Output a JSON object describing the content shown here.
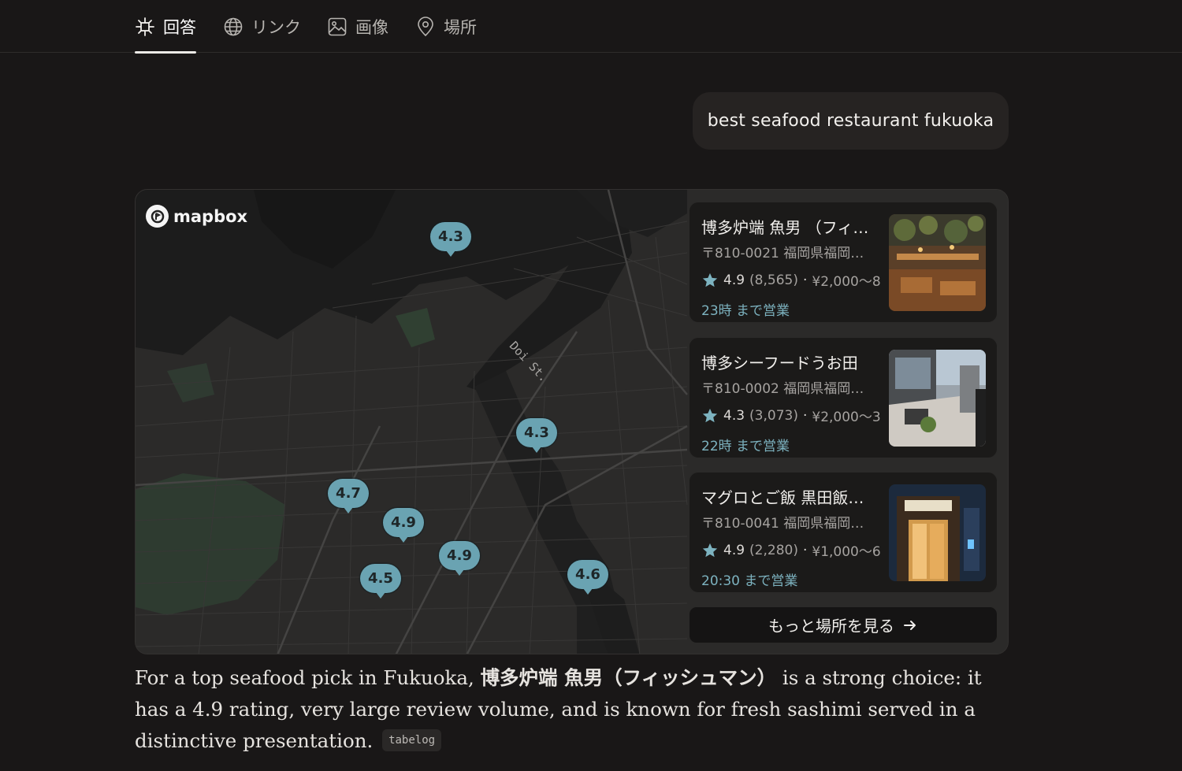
{
  "tabs": [
    {
      "label": "回答",
      "icon": "sparkle-icon"
    },
    {
      "label": "リンク",
      "icon": "globe-icon"
    },
    {
      "label": "画像",
      "icon": "image-icon"
    },
    {
      "label": "場所",
      "icon": "map-pin-icon"
    }
  ],
  "query": "best seafood restaurant fukuoka",
  "map": {
    "brand": "mapbox",
    "street_label": "Doi St.",
    "pins": [
      "4.3",
      "4.3",
      "4.7",
      "4.9",
      "4.9",
      "4.5",
      "4.6"
    ]
  },
  "places": [
    {
      "name": "博多炉端 魚男 （フィ…",
      "address": "〒810-0021 福岡県福岡…",
      "rating": "4.9",
      "reviews": "(8,565)",
      "price": "¥2,000〜8",
      "hours": "23時 まで営業"
    },
    {
      "name": "博多シーフードうお田",
      "address": "〒810-0002 福岡県福岡…",
      "rating": "4.3",
      "reviews": "(3,073)",
      "price": "¥2,000〜3",
      "hours": "22時 まで営業"
    },
    {
      "name": "マグロとご飯 黒田飯…",
      "address": "〒810-0041 福岡県福岡…",
      "rating": "4.9",
      "reviews": "(2,280)",
      "price": "¥1,000〜6",
      "hours": "20:30 まで営業"
    }
  ],
  "more_places_label": "もっと場所を見る",
  "answer": {
    "before": "For a top seafood pick in Fukuoka, ",
    "highlight": "博多炉端 魚男（フィッシュマン）",
    "after": " is a strong choice: it has a 4.9 rating, very large review volume, and is known for fresh sashimi served in a distinctive presentation. ",
    "source": "tabelog"
  },
  "colors": {
    "background": "#191717",
    "pin": "#6aa3b2",
    "hours": "#7db3c0"
  }
}
